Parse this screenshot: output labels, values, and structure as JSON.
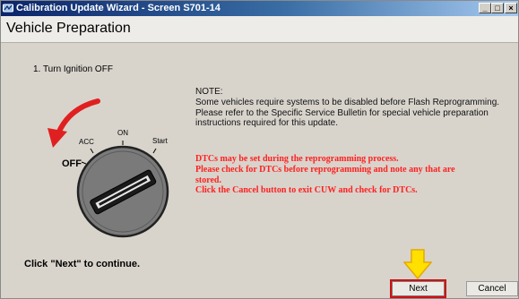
{
  "window": {
    "title": "Calibration Update Wizard - Screen S701-14",
    "icon": "app-icon",
    "controls": [
      "minimize",
      "maximize",
      "close"
    ]
  },
  "header": {
    "title": "Vehicle Preparation"
  },
  "step": {
    "label": "1. Turn Ignition OFF"
  },
  "ignition_diagram": {
    "labels": {
      "acc": "ACC",
      "on": "ON",
      "start": "Start",
      "off": "OFF"
    }
  },
  "note": {
    "lines": [
      "NOTE:",
      "Some vehicles require systems to be disabled before Flash Reprogramming.",
      "Please refer to the Specific Service Bulletin for special vehicle preparation",
      "instructions required for this update."
    ]
  },
  "warning": {
    "lines": [
      "DTCs may be set during the reprogramming process.",
      "Please check for DTCs before reprogramming and note any that are",
      "stored.",
      "Click the Cancel button to exit CUW and check for DTCs."
    ]
  },
  "footer": {
    "instruction": "Click \"Next\" to continue.",
    "next_label": "Next",
    "cancel_label": "Cancel"
  },
  "colors": {
    "warning_text": "#ff2020",
    "highlight_outline": "#d01010",
    "arrow_fill": "#ffe000",
    "turn_arrow": "#e02020"
  }
}
